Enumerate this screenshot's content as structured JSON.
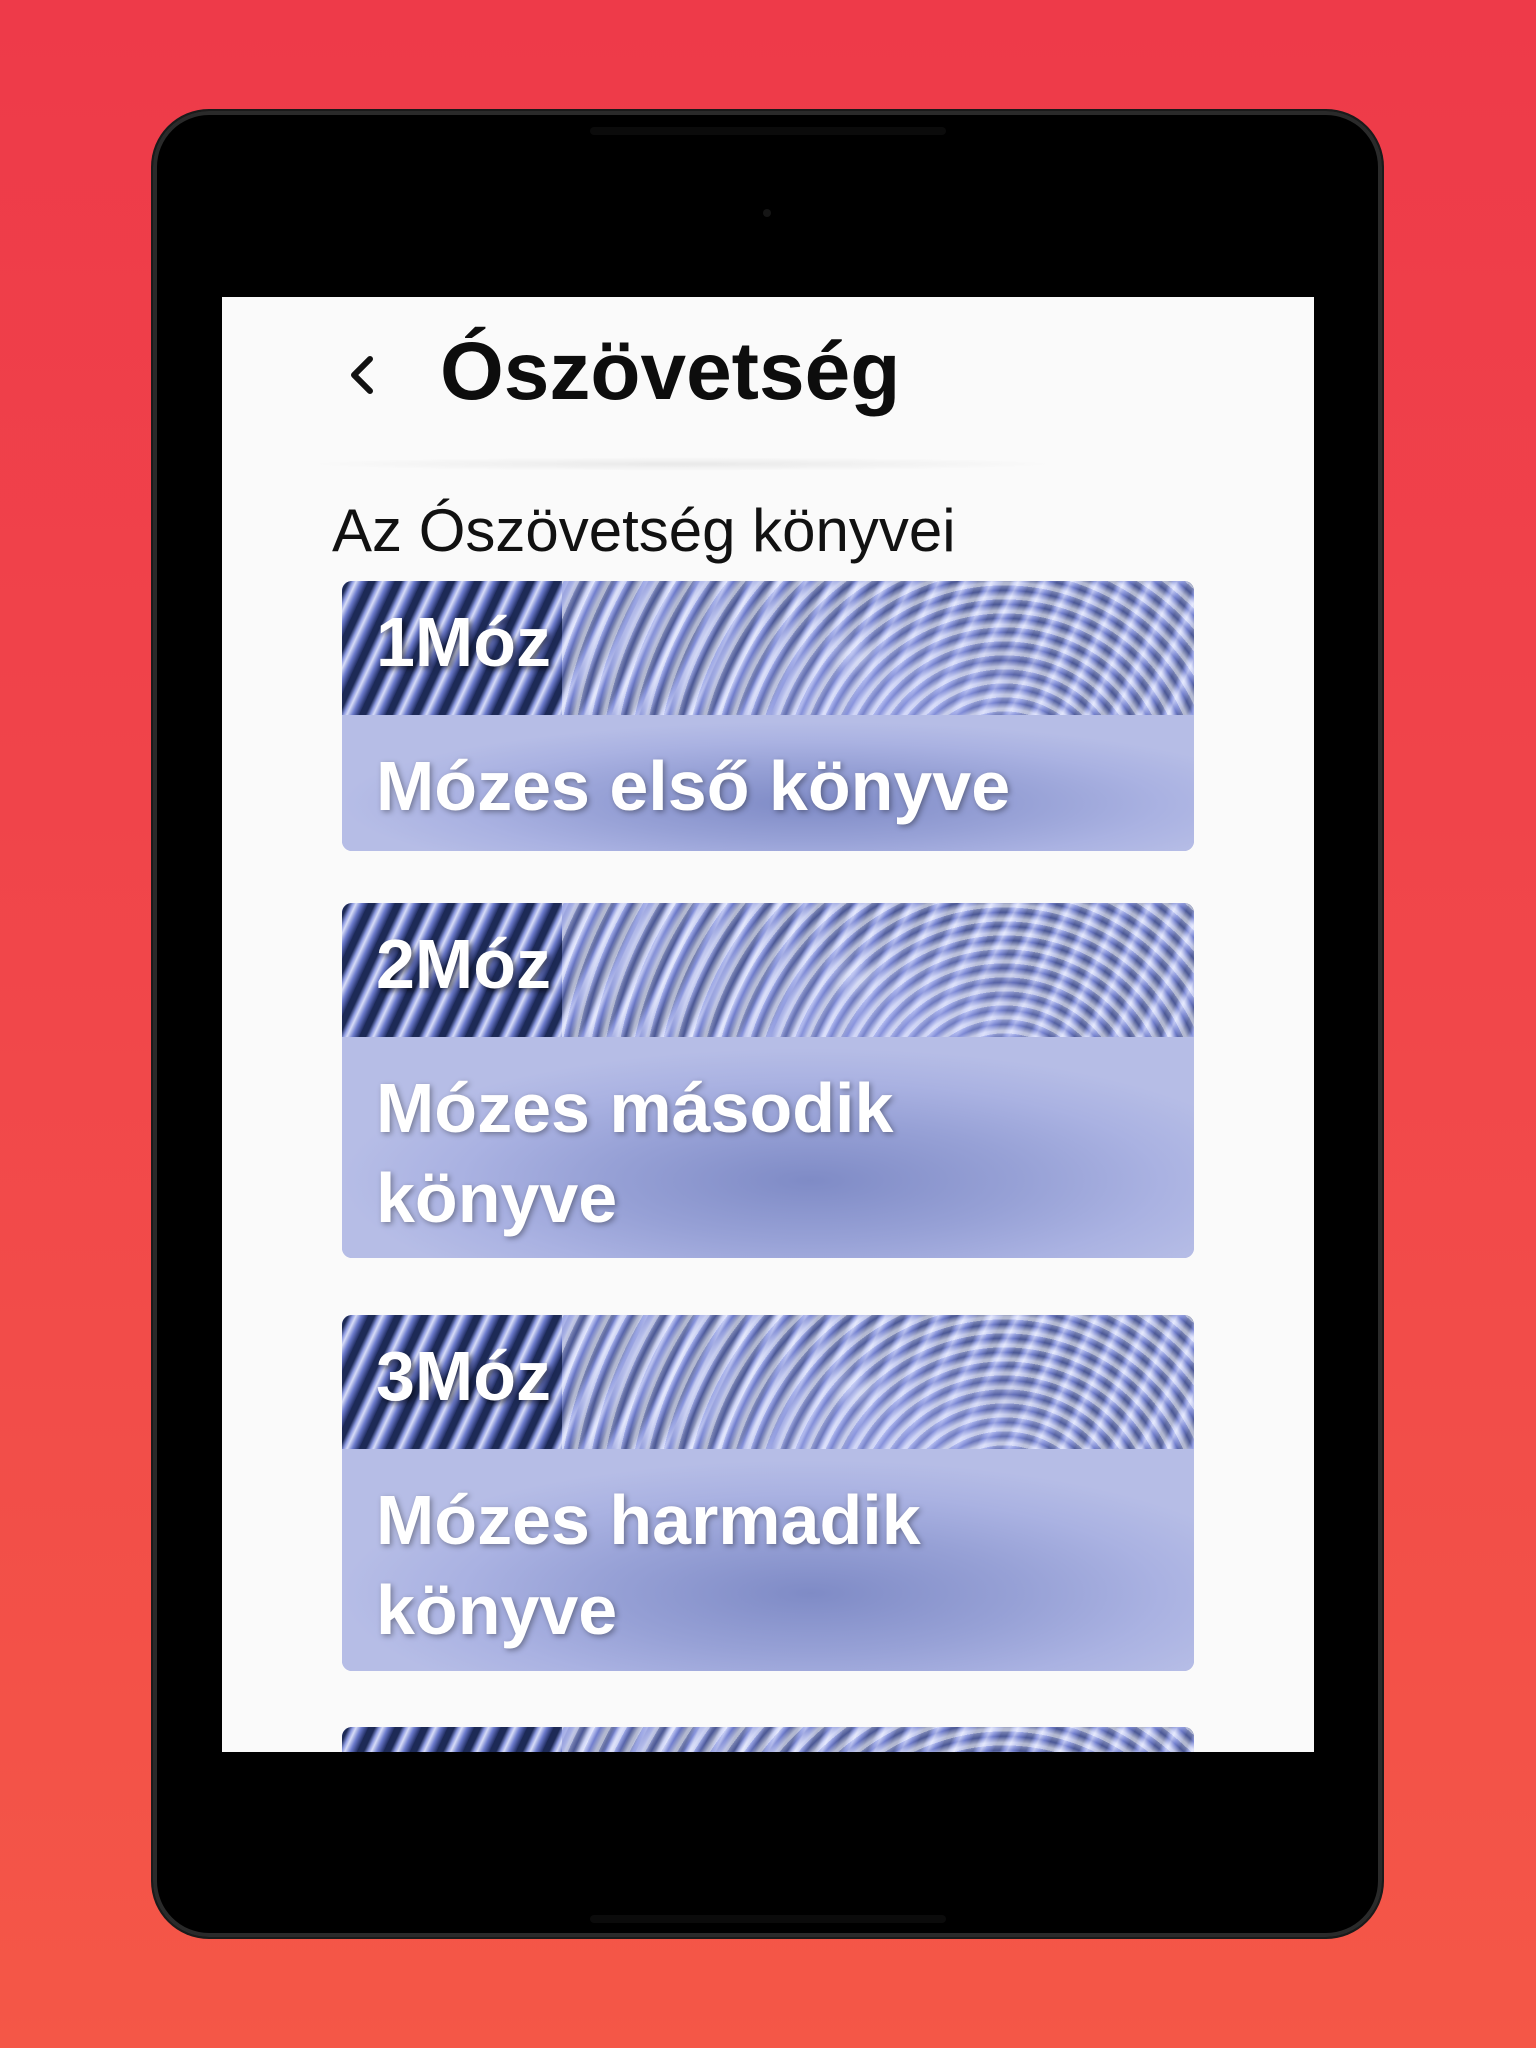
{
  "header": {
    "title": "Ószövetség"
  },
  "section": {
    "heading": "Az Ószövetség könyvei"
  },
  "books": [
    {
      "abbr": "1Móz",
      "name": "Mózes első könyve"
    },
    {
      "abbr": "2Móz",
      "name": "Mózes második könyve"
    },
    {
      "abbr": "3Móz",
      "name": "Mózes harmadik könyve"
    }
  ],
  "icons": {
    "back": "chevron-left-icon"
  },
  "colors": {
    "background_top": "#ee3a49",
    "background_bottom": "#f45747",
    "screen": "#fafafa",
    "card_base": "#a6aede"
  }
}
